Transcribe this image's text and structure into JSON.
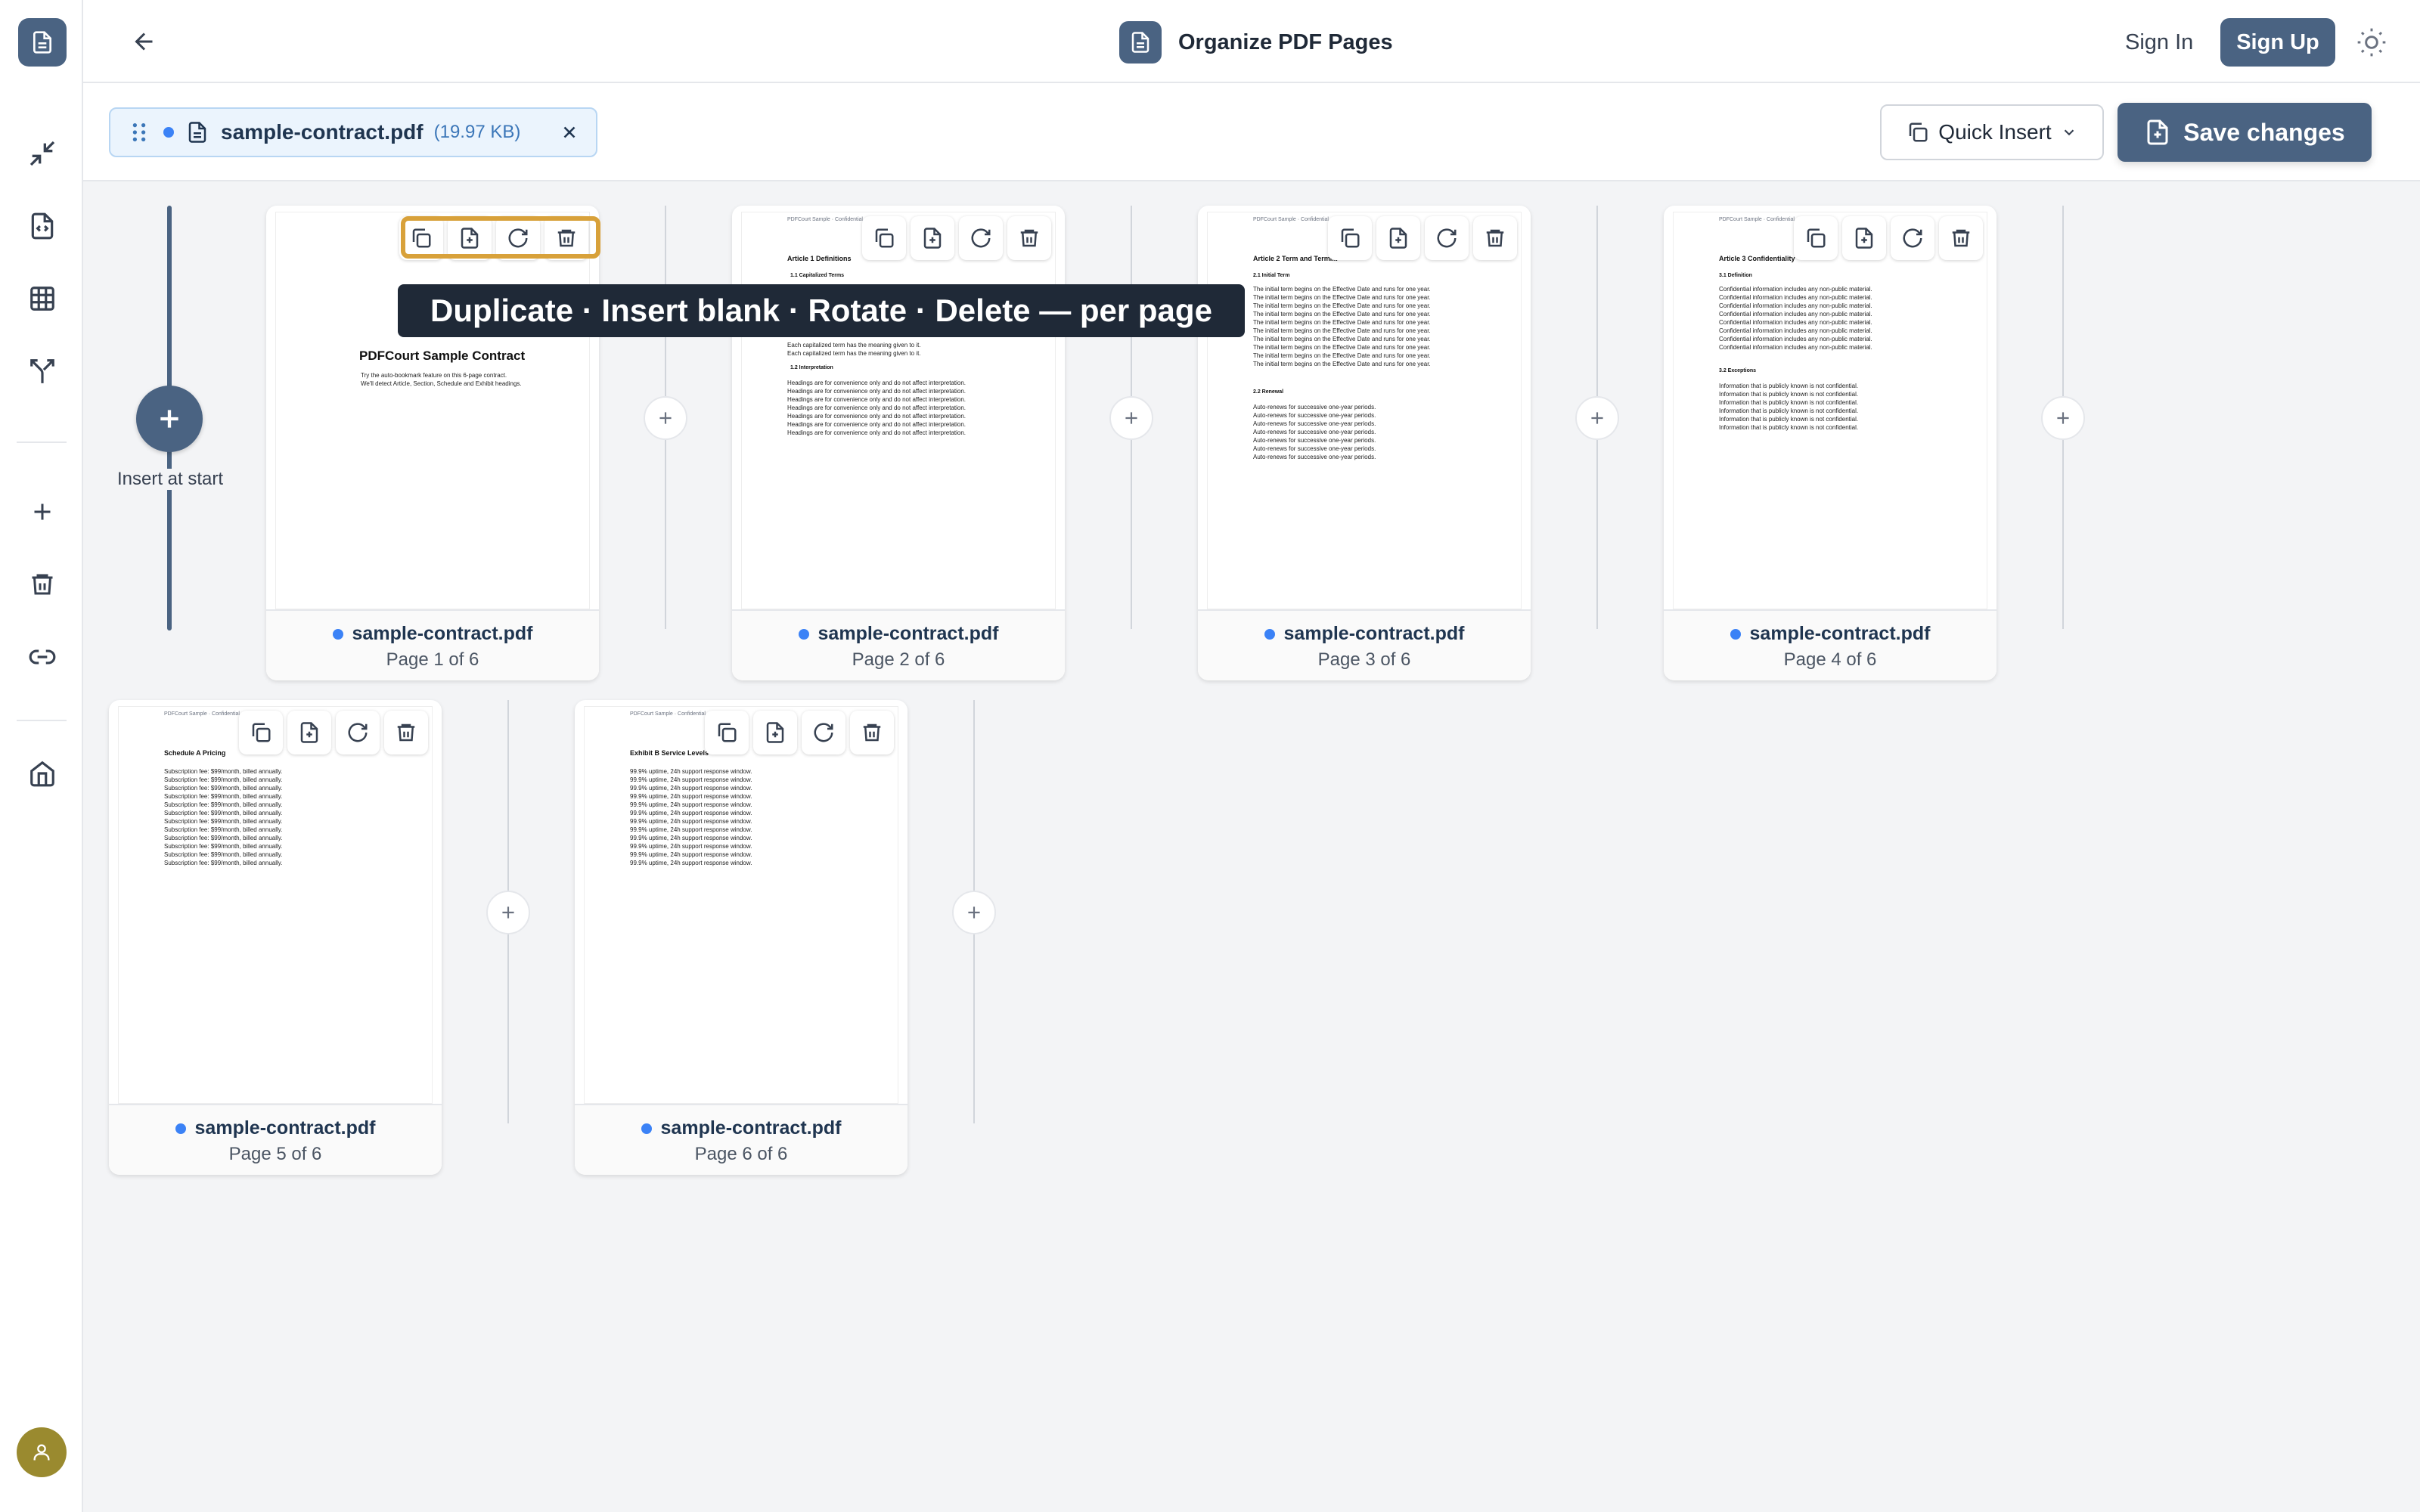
{
  "app": {
    "title": "Organize PDF Pages"
  },
  "header": {
    "sign_in": "Sign In",
    "sign_up": "Sign Up"
  },
  "file": {
    "name": "sample-contract.pdf",
    "size": "(19.97 KB)"
  },
  "toolbar": {
    "quick_insert": "Quick Insert",
    "save": "Save changes"
  },
  "insert_start": {
    "label": "Insert at start"
  },
  "tooltip": {
    "text": "Duplicate · Insert blank · Rotate · Delete — per page"
  },
  "pages": [
    {
      "file": "sample-contract.pdf",
      "label": "Page 1 of 6"
    },
    {
      "file": "sample-contract.pdf",
      "label": "Page 2 of 6"
    },
    {
      "file": "sample-contract.pdf",
      "label": "Page 3 of 6"
    },
    {
      "file": "sample-contract.pdf",
      "label": "Page 4 of 6"
    },
    {
      "file": "sample-contract.pdf",
      "label": "Page 5 of 6"
    },
    {
      "file": "sample-contract.pdf",
      "label": "Page 6 of 6"
    }
  ],
  "page_content": {
    "running_header": "PDFCourt Sample · Confidential",
    "p1": {
      "title": "PDFCourt Sample Contract",
      "lines": [
        "Try the auto-bookmark feature on this 6-page contract.",
        "We'll detect Article, Section, Schedule and Exhibit headings."
      ]
    },
    "p2": {
      "heading": "Article 1  Definitions",
      "s1": "1.1  Capitalized Terms",
      "l1": "Each capitalized term has the meaning given to it.",
      "s2": "1.2  Interpretation",
      "l2": "Headings are for convenience only and do not affect interpretation."
    },
    "p3": {
      "heading": "Article 2  Term and Termi...",
      "s1": "2.1  Initial Term",
      "l1": "The initial term begins on the Effective Date and runs for one year.",
      "s2": "2.2  Renewal",
      "l2": "Auto-renews for successive one-year periods."
    },
    "p4": {
      "heading": "Article 3  Confidentiality",
      "s1": "3.1  Definition",
      "l1": "Confidential information includes any non-public material.",
      "s2": "3.2  Exceptions",
      "l2": "Information that is publicly known is not confidential."
    },
    "p5": {
      "heading": "Schedule A  Pricing",
      "l1": "Subscription fee: $99/month, billed annually."
    },
    "p6": {
      "heading": "Exhibit B  Service Levels",
      "l1": "99.9% uptime, 24h support response window."
    }
  }
}
